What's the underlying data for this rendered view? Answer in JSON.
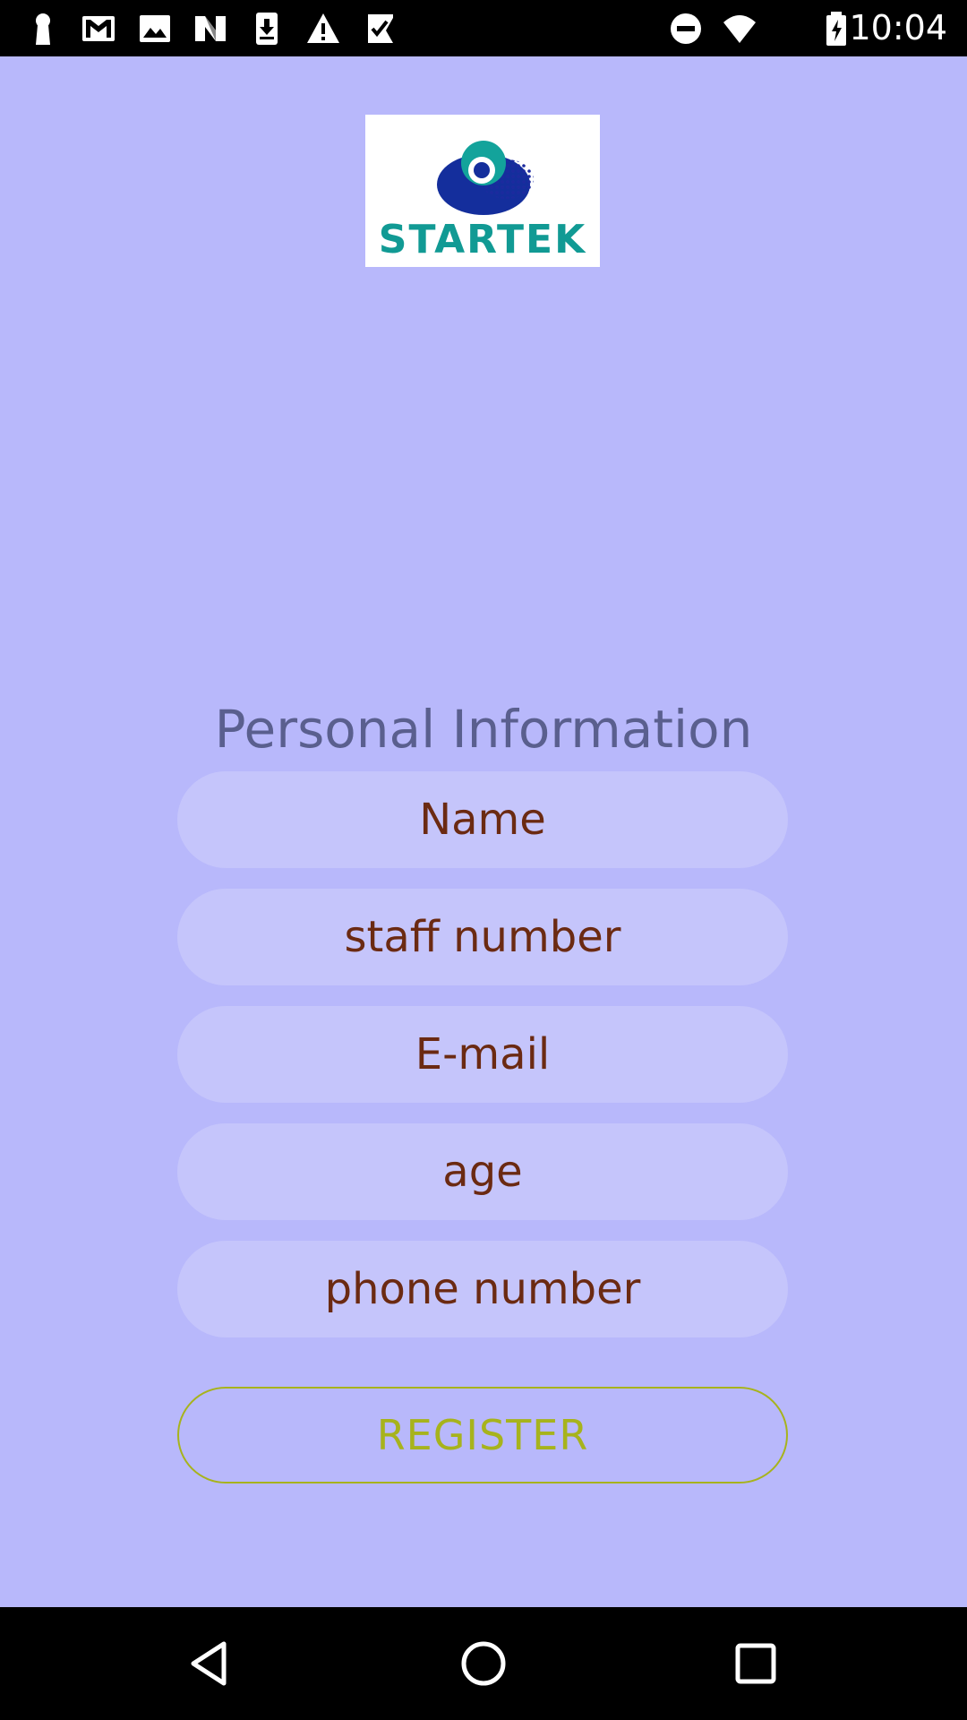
{
  "status_bar": {
    "time": "10:04",
    "left_icons": [
      "keyhole-icon",
      "gmail-icon",
      "photo-icon",
      "n-app-icon",
      "download-icon",
      "warning-icon",
      "check-flag-icon"
    ],
    "right_icons": [
      "do-not-disturb-icon",
      "wifi-icon",
      "battery-icon"
    ]
  },
  "logo": {
    "text": "STARTEK"
  },
  "form": {
    "title": "Personal Information",
    "fields": {
      "name": {
        "placeholder": "Name",
        "value": ""
      },
      "staff_number": {
        "placeholder": "staff number",
        "value": ""
      },
      "email": {
        "placeholder": "E-mail",
        "value": ""
      },
      "age": {
        "placeholder": "age",
        "value": ""
      },
      "phone_number": {
        "placeholder": "phone number",
        "value": ""
      }
    },
    "register_label": "REGISTER"
  },
  "nav_bar": {
    "icons": [
      "back-icon",
      "home-icon",
      "recents-icon"
    ]
  },
  "colors": {
    "background": "#b8b8fb",
    "field_background": "#c5c5fb",
    "field_text": "#6b2a12",
    "title_text": "#5a5f8e",
    "register_accent": "#a7b31c",
    "logo_text": "#119a94"
  }
}
